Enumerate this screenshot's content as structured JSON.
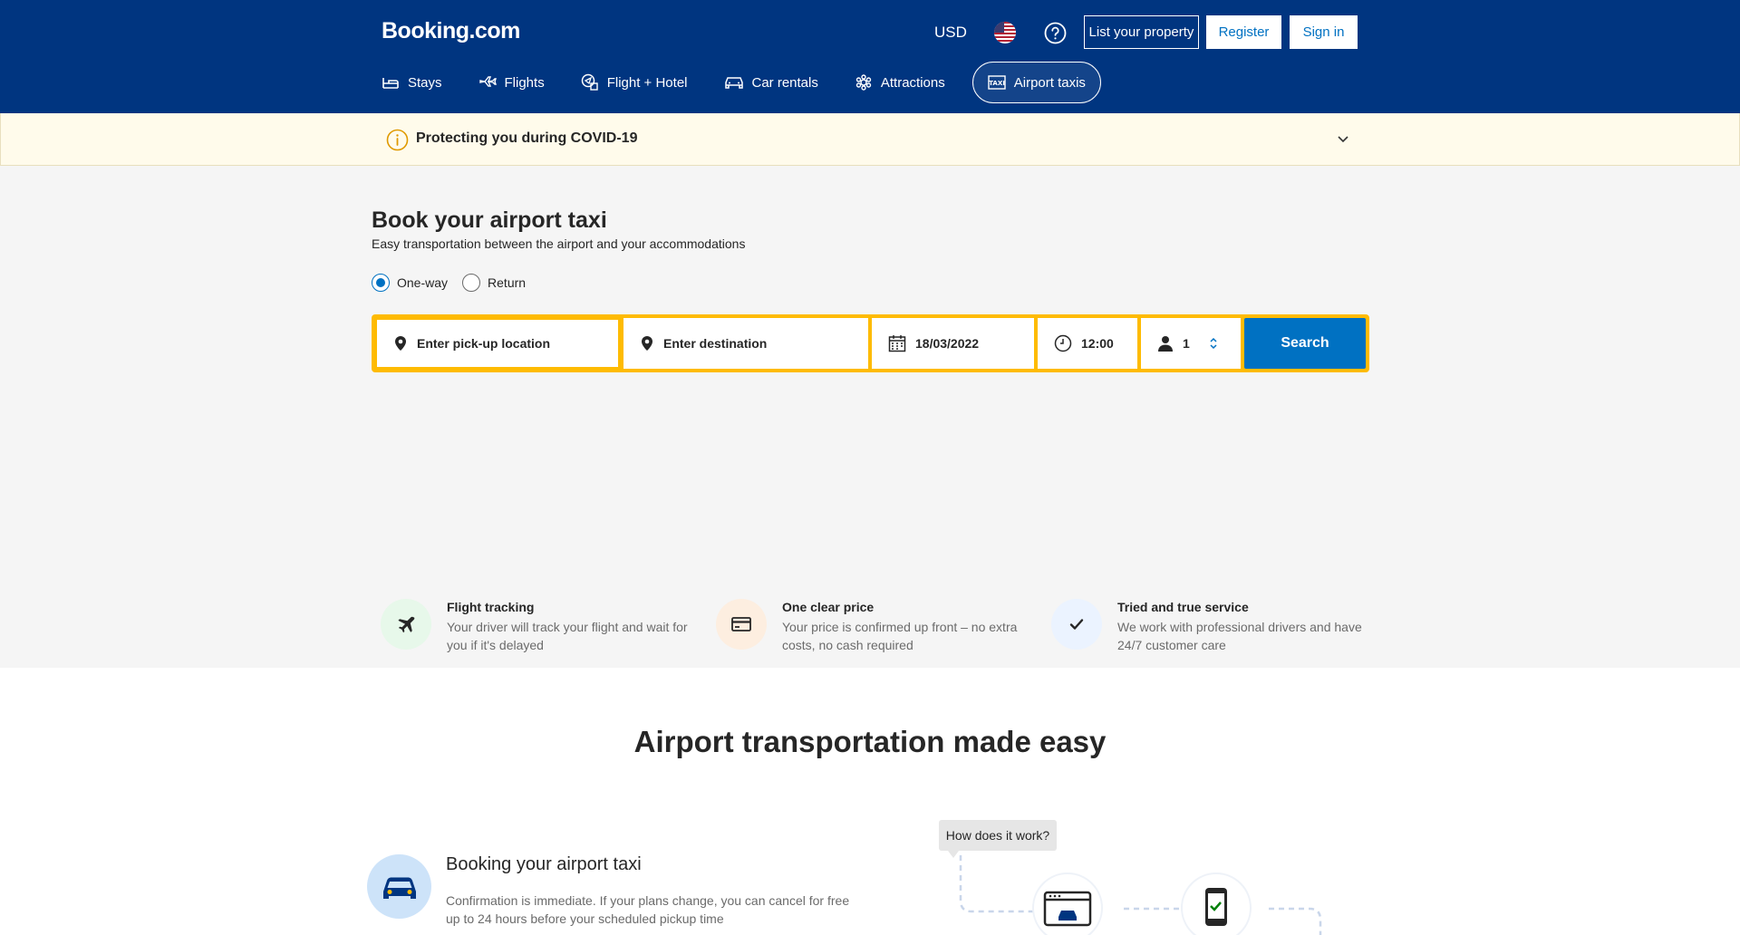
{
  "header": {
    "logo": "Booking.com",
    "currency": "USD",
    "list_property": "List your property",
    "register": "Register",
    "sign_in": "Sign in"
  },
  "nav": {
    "items": [
      {
        "label": "Stays",
        "icon": "bed-icon"
      },
      {
        "label": "Flights",
        "icon": "plane-icon"
      },
      {
        "label": "Flight + Hotel",
        "icon": "flight-hotel-icon"
      },
      {
        "label": "Car rentals",
        "icon": "car-icon"
      },
      {
        "label": "Attractions",
        "icon": "attractions-icon"
      },
      {
        "label": "Airport taxis",
        "icon": "taxi-icon",
        "active": true
      }
    ]
  },
  "covid": {
    "text": "Protecting you during COVID-19"
  },
  "booking": {
    "title": "Book your airport taxi",
    "subtitle": "Easy transportation between the airport and your accommodations",
    "trip_types": [
      "One-way",
      "Return"
    ],
    "selected_trip": "One-way",
    "pickup_placeholder": "Enter pick-up location",
    "destination_placeholder": "Enter destination",
    "date": "18/03/2022",
    "time": "12:00",
    "passengers": "1",
    "search_label": "Search"
  },
  "features": [
    {
      "title": "Flight tracking",
      "desc": "Your driver will track your flight and wait for you if it's delayed"
    },
    {
      "title": "One clear price",
      "desc": "Your price is confirmed up front – no extra costs, no cash required"
    },
    {
      "title": "Tried and true service",
      "desc": "We work with professional drivers and have 24/7 customer care"
    }
  ],
  "how": {
    "heading": "Airport transportation made easy",
    "step_title": "Booking your airport taxi",
    "step_desc": "Confirmation is immediate. If your plans change, you can cancel for free up to 24 hours before your scheduled pickup time",
    "bubble": "How does it work?"
  },
  "colors": {
    "brand": "#003580",
    "accent": "#0071c2",
    "search_border": "#febb02"
  }
}
